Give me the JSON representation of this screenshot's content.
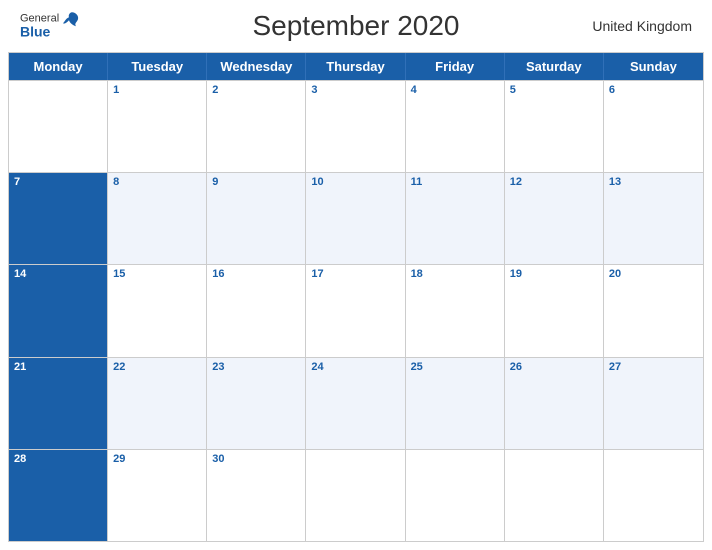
{
  "header": {
    "logo_general": "General",
    "logo_blue": "Blue",
    "title": "September 2020",
    "country": "United Kingdom"
  },
  "calendar": {
    "day_headers": [
      "Monday",
      "Tuesday",
      "Wednesday",
      "Thursday",
      "Friday",
      "Saturday",
      "Sunday"
    ],
    "weeks": [
      [
        {
          "day": "",
          "empty": true
        },
        {
          "day": "1"
        },
        {
          "day": "2"
        },
        {
          "day": "3"
        },
        {
          "day": "4"
        },
        {
          "day": "5"
        },
        {
          "day": "6"
        }
      ],
      [
        {
          "day": "7"
        },
        {
          "day": "8"
        },
        {
          "day": "9"
        },
        {
          "day": "10"
        },
        {
          "day": "11"
        },
        {
          "day": "12"
        },
        {
          "day": "13"
        }
      ],
      [
        {
          "day": "14"
        },
        {
          "day": "15"
        },
        {
          "day": "16"
        },
        {
          "day": "17"
        },
        {
          "day": "18"
        },
        {
          "day": "19"
        },
        {
          "day": "20"
        }
      ],
      [
        {
          "day": "21"
        },
        {
          "day": "22"
        },
        {
          "day": "23"
        },
        {
          "day": "24"
        },
        {
          "day": "25"
        },
        {
          "day": "26"
        },
        {
          "day": "27"
        }
      ],
      [
        {
          "day": "28"
        },
        {
          "day": "29"
        },
        {
          "day": "30"
        },
        {
          "day": "",
          "empty": true
        },
        {
          "day": "",
          "empty": true
        },
        {
          "day": "",
          "empty": true
        },
        {
          "day": "",
          "empty": true
        }
      ]
    ]
  }
}
